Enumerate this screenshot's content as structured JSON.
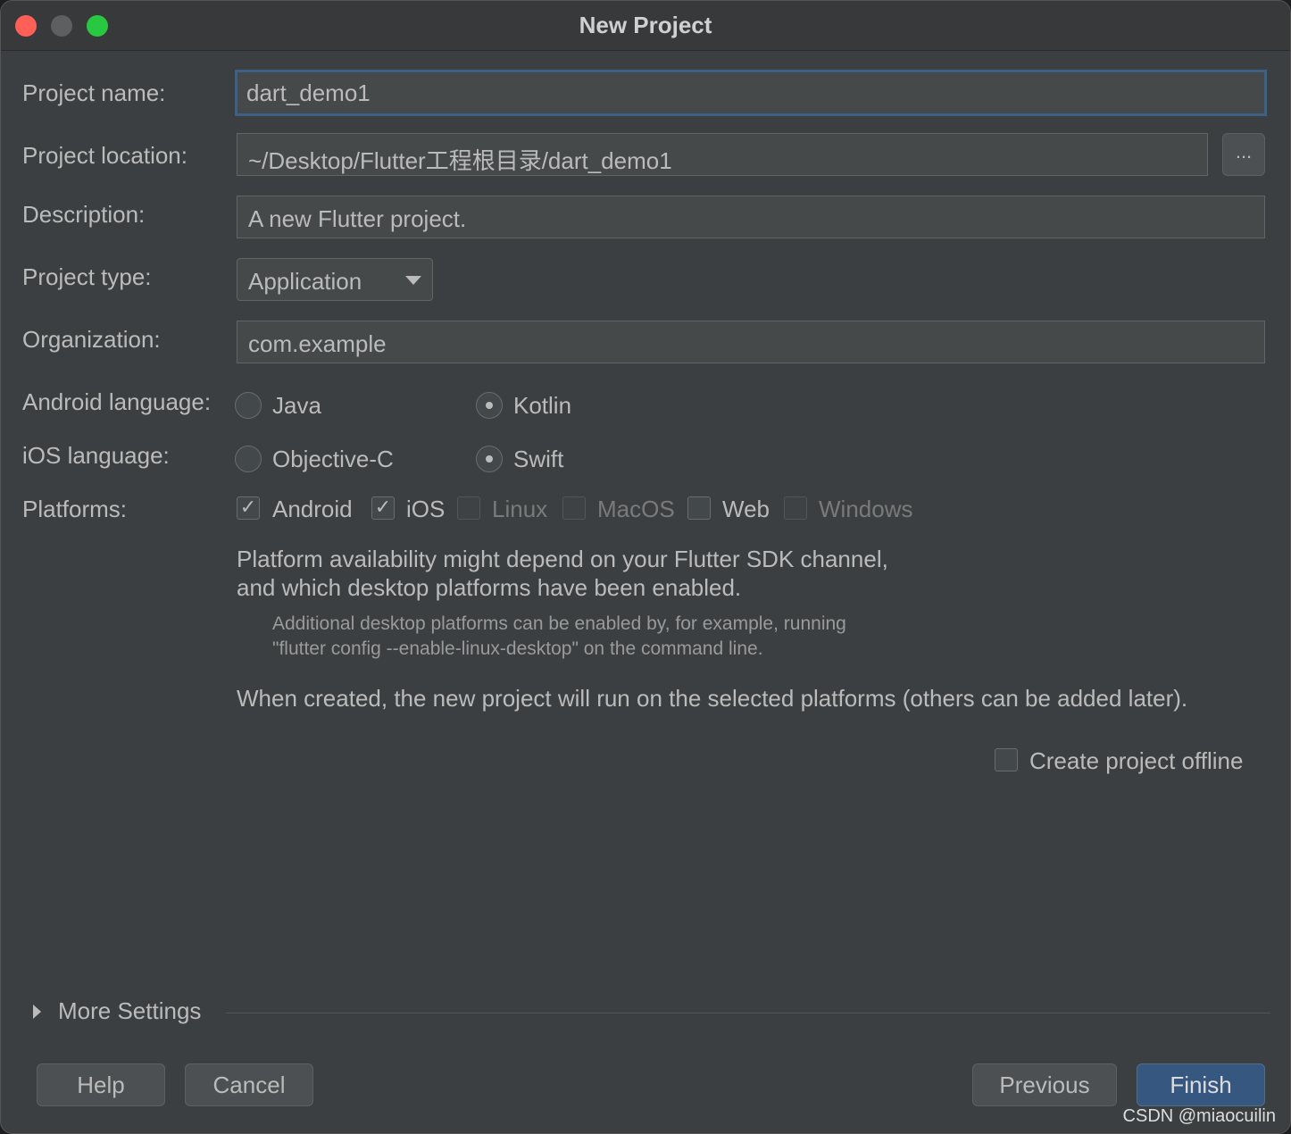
{
  "window": {
    "title": "New Project"
  },
  "form": {
    "project_name": {
      "label": "Project name:",
      "value": "dart_demo1"
    },
    "project_location": {
      "label": "Project location:",
      "value": "~/Desktop/Flutter工程根目录/dart_demo1",
      "browse_label": "..."
    },
    "description": {
      "label": "Description:",
      "value": "A new Flutter project."
    },
    "project_type": {
      "label": "Project type:",
      "value": "Application"
    },
    "organization": {
      "label": "Organization:",
      "value": "com.example"
    },
    "android_language": {
      "label": "Android language:",
      "options": [
        {
          "label": "Java",
          "selected": false
        },
        {
          "label": "Kotlin",
          "selected": true
        }
      ]
    },
    "ios_language": {
      "label": "iOS language:",
      "options": [
        {
          "label": "Objective-C",
          "selected": false
        },
        {
          "label": "Swift",
          "selected": true
        }
      ]
    },
    "platforms": {
      "label": "Platforms:",
      "options": [
        {
          "label": "Android",
          "checked": true,
          "enabled": true
        },
        {
          "label": "iOS",
          "checked": true,
          "enabled": true
        },
        {
          "label": "Linux",
          "checked": false,
          "enabled": false
        },
        {
          "label": "MacOS",
          "checked": false,
          "enabled": false
        },
        {
          "label": "Web",
          "checked": false,
          "enabled": true
        },
        {
          "label": "Windows",
          "checked": false,
          "enabled": false
        }
      ]
    },
    "info": {
      "line1": "Platform availability might depend on your Flutter SDK channel,",
      "line2": "and which desktop platforms have been enabled.",
      "hint1": "Additional desktop platforms can be enabled by, for example, running",
      "hint2": "\"flutter config --enable-linux-desktop\" on the command line.",
      "created_note": "When created, the new project will run on the selected platforms (others can be added later)."
    },
    "offline": {
      "label": "Create project offline",
      "checked": false
    }
  },
  "more_settings": {
    "label": "More Settings"
  },
  "buttons": {
    "help": "Help",
    "cancel": "Cancel",
    "previous": "Previous",
    "finish": "Finish"
  },
  "watermark": "CSDN @miaocuilin",
  "icons": {
    "check": "✓",
    "caret": "chevron-down-icon",
    "expand": "triangle-right-icon"
  }
}
